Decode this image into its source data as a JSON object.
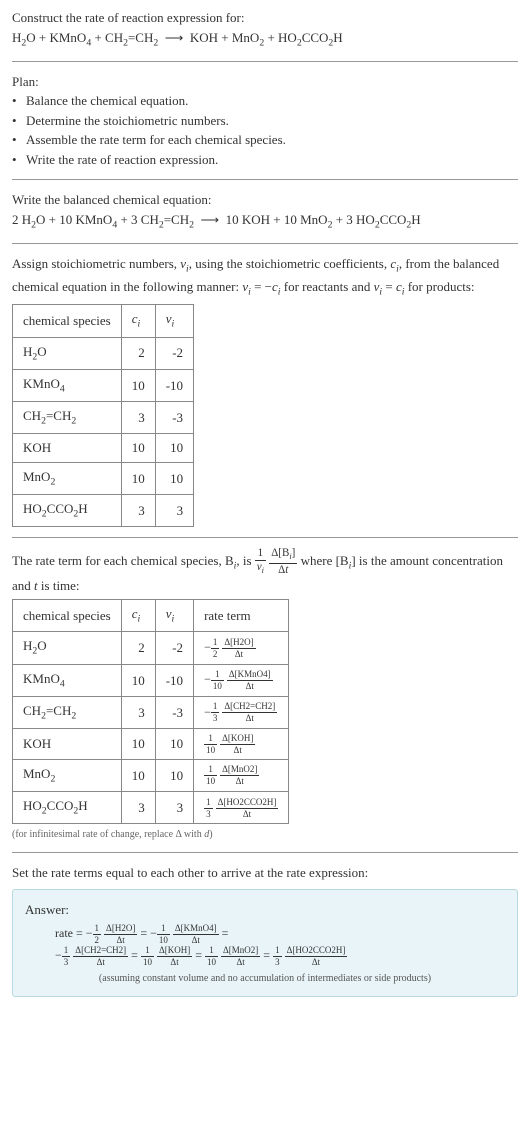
{
  "header": {
    "prompt": "Construct the rate of reaction expression for:",
    "equation_html": "H<sub>2</sub>O + KMnO<sub>4</sub> + CH<sub>2</sub>=CH<sub>2</sub> &nbsp;⟶&nbsp; KOH + MnO<sub>2</sub> + HO<sub>2</sub>CCO<sub>2</sub>H"
  },
  "plan": {
    "title": "Plan:",
    "items": [
      "Balance the chemical equation.",
      "Determine the stoichiometric numbers.",
      "Assemble the rate term for each chemical species.",
      "Write the rate of reaction expression."
    ]
  },
  "balanced": {
    "title": "Write the balanced chemical equation:",
    "equation_html": "2 H<sub>2</sub>O + 10 KMnO<sub>4</sub> + 3 CH<sub>2</sub>=CH<sub>2</sub> &nbsp;⟶&nbsp; 10 KOH + 10 MnO<sub>2</sub> + 3 HO<sub>2</sub>CCO<sub>2</sub>H"
  },
  "stoich": {
    "intro_html": "Assign stoichiometric numbers, <i>ν<sub>i</sub></i>, using the stoichiometric coefficients, <i>c<sub>i</sub></i>, from the balanced chemical equation in the following manner: <i>ν<sub>i</sub></i> = −<i>c<sub>i</sub></i> for reactants and <i>ν<sub>i</sub></i> = <i>c<sub>i</sub></i> for products:",
    "headers": {
      "species": "chemical species",
      "c": "cᵢ",
      "v": "νᵢ"
    },
    "rows": [
      {
        "species_html": "H<sub>2</sub>O",
        "c": "2",
        "v": "-2"
      },
      {
        "species_html": "KMnO<sub>4</sub>",
        "c": "10",
        "v": "-10"
      },
      {
        "species_html": "CH<sub>2</sub>=CH<sub>2</sub>",
        "c": "3",
        "v": "-3"
      },
      {
        "species_html": "KOH",
        "c": "10",
        "v": "10"
      },
      {
        "species_html": "MnO<sub>2</sub>",
        "c": "10",
        "v": "10"
      },
      {
        "species_html": "HO<sub>2</sub>CCO<sub>2</sub>H",
        "c": "3",
        "v": "3"
      }
    ]
  },
  "rate_terms": {
    "intro_pre": "The rate term for each chemical species, B",
    "intro_mid": ", is ",
    "intro_frac1_num": "1",
    "intro_frac1_den_html": "<i>ν<sub>i</sub></i>",
    "intro_frac2_num_html": "Δ[B<sub><i>i</i></sub>]",
    "intro_frac2_den_html": "Δ<i>t</i>",
    "intro_post_html": " where [B<sub><i>i</i></sub>] is the amount concentration and <i>t</i> is time:",
    "headers": {
      "species": "chemical species",
      "c": "cᵢ",
      "v": "νᵢ",
      "rate": "rate term"
    },
    "rows": [
      {
        "species_html": "H<sub>2</sub>O",
        "c": "2",
        "v": "-2",
        "sign": "−",
        "coef_num": "1",
        "coef_den": "2",
        "delta_num": "Δ[H2O]",
        "delta_den": "Δt"
      },
      {
        "species_html": "KMnO<sub>4</sub>",
        "c": "10",
        "v": "-10",
        "sign": "−",
        "coef_num": "1",
        "coef_den": "10",
        "delta_num": "Δ[KMnO4]",
        "delta_den": "Δt"
      },
      {
        "species_html": "CH<sub>2</sub>=CH<sub>2</sub>",
        "c": "3",
        "v": "-3",
        "sign": "−",
        "coef_num": "1",
        "coef_den": "3",
        "delta_num": "Δ[CH2=CH2]",
        "delta_den": "Δt"
      },
      {
        "species_html": "KOH",
        "c": "10",
        "v": "10",
        "sign": "",
        "coef_num": "1",
        "coef_den": "10",
        "delta_num": "Δ[KOH]",
        "delta_den": "Δt"
      },
      {
        "species_html": "MnO<sub>2</sub>",
        "c": "10",
        "v": "10",
        "sign": "",
        "coef_num": "1",
        "coef_den": "10",
        "delta_num": "Δ[MnO2]",
        "delta_den": "Δt"
      },
      {
        "species_html": "HO<sub>2</sub>CCO<sub>2</sub>H",
        "c": "3",
        "v": "3",
        "sign": "",
        "coef_num": "1",
        "coef_den": "3",
        "delta_num": "Δ[HO2CCO2H]",
        "delta_den": "Δt"
      }
    ],
    "note_html": "(for infinitesimal rate of change, replace Δ with <i>d</i>)"
  },
  "final": {
    "intro": "Set the rate terms equal to each other to arrive at the rate expression:",
    "answer_label": "Answer:",
    "rate_prefix": "rate = ",
    "terms": [
      {
        "sign": "−",
        "coef_num": "1",
        "coef_den": "2",
        "delta_num": "Δ[H2O]",
        "delta_den": "Δt"
      },
      {
        "sign": "−",
        "coef_num": "1",
        "coef_den": "10",
        "delta_num": "Δ[KMnO4]",
        "delta_den": "Δt"
      },
      {
        "sign": "−",
        "coef_num": "1",
        "coef_den": "3",
        "delta_num": "Δ[CH2=CH2]",
        "delta_den": "Δt"
      },
      {
        "sign": "",
        "coef_num": "1",
        "coef_den": "10",
        "delta_num": "Δ[KOH]",
        "delta_den": "Δt"
      },
      {
        "sign": "",
        "coef_num": "1",
        "coef_den": "10",
        "delta_num": "Δ[MnO2]",
        "delta_den": "Δt"
      },
      {
        "sign": "",
        "coef_num": "1",
        "coef_den": "3",
        "delta_num": "Δ[HO2CCO2H]",
        "delta_den": "Δt"
      }
    ],
    "note": "(assuming constant volume and no accumulation of intermediates or side products)"
  },
  "chart_data": {
    "type": "table",
    "title": "Stoichiometric numbers and rate terms",
    "species": [
      "H2O",
      "KMnO4",
      "CH2=CH2",
      "KOH",
      "MnO2",
      "HO2CCO2H"
    ],
    "c_i": [
      2,
      10,
      3,
      10,
      10,
      3
    ],
    "nu_i": [
      -2,
      -10,
      -3,
      10,
      10,
      3
    ],
    "balanced_reactants": {
      "H2O": 2,
      "KMnO4": 10,
      "CH2=CH2": 3
    },
    "balanced_products": {
      "KOH": 10,
      "MnO2": 10,
      "HO2CCO2H": 3
    }
  }
}
